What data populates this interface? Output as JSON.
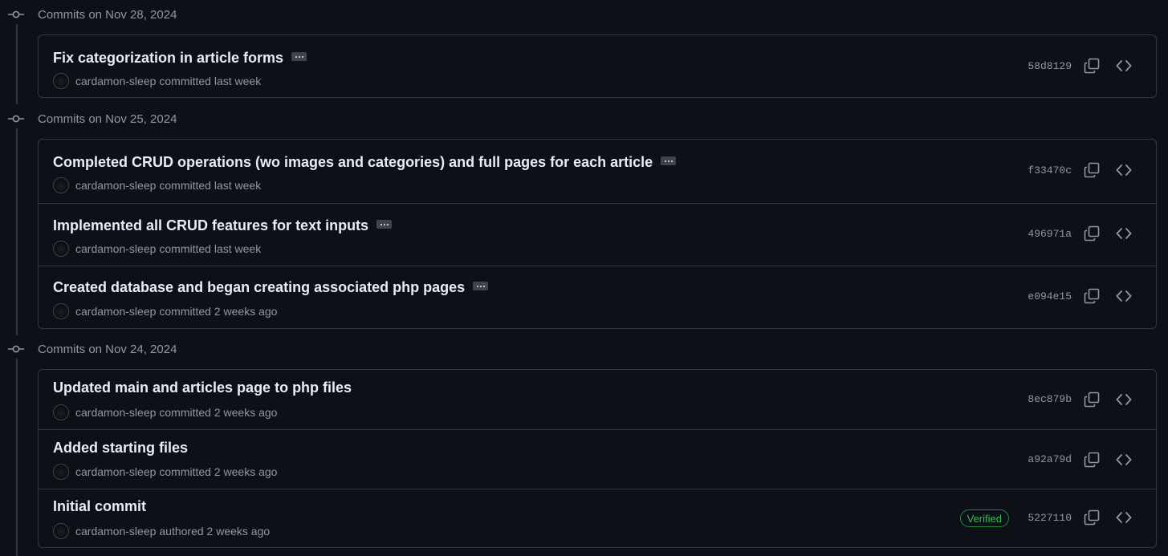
{
  "colors": {
    "background": "#0d1117",
    "border": "#30363d",
    "text": "#e6edf3",
    "muted": "#9198a1",
    "verified": "#3fb950"
  },
  "groups": [
    {
      "title": "Commits on Nov 28, 2024",
      "commits": [
        {
          "message": "Fix categorization in article forms",
          "author": "cardamon-sleep",
          "action": "committed last week",
          "sha": "58d8129",
          "has_ellipsis": true
        }
      ]
    },
    {
      "title": "Commits on Nov 25, 2024",
      "commits": [
        {
          "message": "Completed CRUD operations (wo images and categories) and full pages for each article",
          "author": "cardamon-sleep",
          "action": "committed last week",
          "sha": "f33470c",
          "has_ellipsis": true
        },
        {
          "message": "Implemented all CRUD features for text inputs",
          "author": "cardamon-sleep",
          "action": "committed last week",
          "sha": "496971a",
          "has_ellipsis": true
        },
        {
          "message": "Created database and began creating associated php pages",
          "author": "cardamon-sleep",
          "action": "committed 2 weeks ago",
          "sha": "e094e15",
          "has_ellipsis": true
        }
      ]
    },
    {
      "title": "Commits on Nov 24, 2024",
      "commits": [
        {
          "message": "Updated main and articles page to php files",
          "author": "cardamon-sleep",
          "action": "committed 2 weeks ago",
          "sha": "8ec879b",
          "has_ellipsis": false
        },
        {
          "message": "Added starting files",
          "author": "cardamon-sleep",
          "action": "committed 2 weeks ago",
          "sha": "a92a79d",
          "has_ellipsis": false
        },
        {
          "message": "Initial commit",
          "author": "cardamon-sleep",
          "action": "authored 2 weeks ago",
          "sha": "5227110",
          "has_ellipsis": false,
          "badge": "Verified"
        }
      ]
    }
  ]
}
